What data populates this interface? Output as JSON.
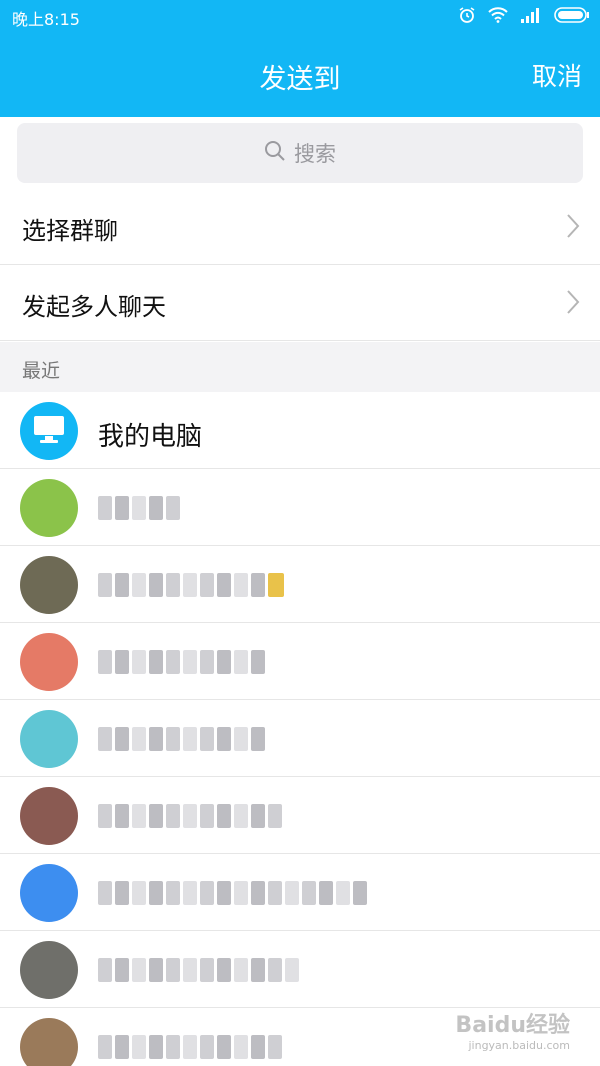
{
  "status_bar": {
    "time": "晚上8:15",
    "icons": [
      "alarm-icon",
      "wifi-icon",
      "signal-icon",
      "battery-icon"
    ]
  },
  "header": {
    "title": "发送到",
    "cancel_label": "取消"
  },
  "search": {
    "placeholder": "搜索"
  },
  "menu": [
    {
      "label": "选择群聊"
    },
    {
      "label": "发起多人聊天"
    }
  ],
  "section": {
    "label": "最近"
  },
  "recent": [
    {
      "name": "我的电脑",
      "avatar": "computer-icon"
    },
    {
      "name": "",
      "avatar_color": "#8bc34a"
    },
    {
      "name": "",
      "avatar_color": "#6e6a55"
    },
    {
      "name": "",
      "avatar_color": "#e57a66"
    },
    {
      "name": "",
      "avatar_color": "#5fc6d4"
    },
    {
      "name": "",
      "avatar_color": "#8a5a52"
    },
    {
      "name": "",
      "avatar_color": "#3d8ef0"
    },
    {
      "name": "",
      "avatar_color": "#6f6f6a"
    },
    {
      "name": "",
      "avatar_color": "#9a7a5a"
    }
  ],
  "watermark": {
    "text": "Baidu经验",
    "sub": "jingyan.baidu.com"
  },
  "colors": {
    "accent": "#12b7f5",
    "divider": "#e6e6e6",
    "section_bg": "#f3f3f5"
  }
}
